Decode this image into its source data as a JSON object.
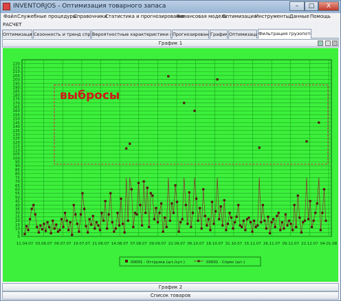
{
  "window": {
    "title": "INVENTORJOS - Оптимизация товарного запаса",
    "minimize_label": "–",
    "maximize_label": "□",
    "close_label": "X"
  },
  "menu": [
    "Файл",
    "Служебные процедуры",
    "Справочники",
    "Статистика и прогнозирование",
    "Финансовая модель",
    "Оптимизация",
    "Инструменты",
    "Данные",
    "Помощь"
  ],
  "section_label": "РАСЧЕТ",
  "tabs": [
    {
      "label": "Оптимизация",
      "active": false
    },
    {
      "label": "Сезонность и тренд спроса",
      "active": false
    },
    {
      "label": "Вероятностные характеристики спроса",
      "active": false
    },
    {
      "label": "Прогнозирование",
      "active": false
    },
    {
      "label": "Графики",
      "active": false
    },
    {
      "label": "Оптимизация",
      "active": false
    },
    {
      "label": "Фильтрация грузопотока",
      "active": true
    }
  ],
  "panel": {
    "title": "График 1"
  },
  "footer": {
    "panel2_title": "График 2",
    "goods_list": "Список товаров"
  },
  "colors": {
    "plot_bg": "#3cf03c",
    "grid": "#1aa01a",
    "line": "#8b2e2e",
    "marker": "#5a1010",
    "outlier_box": "#c04040",
    "annotation": "#d01818"
  },
  "chart_data": {
    "type": "line",
    "annotation": "выбросы",
    "ylim": [
      0,
      225
    ],
    "yticks": [
      0,
      5,
      10,
      15,
      20,
      25,
      30,
      35,
      40,
      45,
      50,
      55,
      60,
      65,
      70,
      75,
      80,
      85,
      90,
      95,
      100,
      105,
      110,
      115,
      120,
      125,
      130,
      135,
      140,
      145,
      150,
      155,
      160,
      165,
      170,
      175,
      180,
      185,
      190,
      195,
      200,
      205,
      210,
      215,
      220
    ],
    "x_tick_labels": [
      "11.04.07",
      "03.06.07",
      "06.07.07",
      "19.07.07",
      "21.06.07",
      "14.08.07",
      "07.08.07",
      "09.09.07",
      "22.09.07",
      "06.10.07",
      "18.10.07",
      "31.10.07",
      "15.11.07",
      "26.11.07",
      "09.12.07",
      "22.12.07",
      "04.01.08"
    ],
    "series": [
      {
        "name": "00001 - Отгрузка (шт./сут.)",
        "values": [
          3,
          13,
          8,
          22,
          35,
          40,
          28,
          12,
          5,
          14,
          9,
          16,
          7,
          18,
          12,
          4,
          20,
          10,
          15,
          6,
          8,
          22,
          12,
          30,
          20,
          8,
          18,
          2,
          40,
          28,
          16,
          6,
          28,
          55,
          35,
          13,
          5,
          22,
          15,
          26,
          10,
          18,
          14,
          8,
          30,
          20,
          45,
          10,
          28,
          55,
          18,
          6,
          10,
          30,
          14,
          48,
          16,
          5,
          112,
          20,
          118,
          60,
          12,
          30,
          28,
          68,
          40,
          14,
          70,
          30,
          62,
          12,
          55,
          52,
          22,
          36,
          18,
          30,
          42,
          6,
          24,
          12,
          204,
          20,
          42,
          30,
          65,
          44,
          6,
          18,
          22,
          170,
          40,
          16,
          56,
          12,
          30,
          160,
          48,
          20,
          36,
          10,
          60,
          26,
          14,
          22,
          8,
          44,
          16,
          32,
          200,
          22,
          38,
          14,
          46,
          8,
          16,
          30,
          24,
          10,
          18,
          25,
          40,
          14,
          12,
          20,
          8,
          22,
          24,
          18,
          6,
          20,
          12,
          14,
          113,
          18,
          40,
          20,
          10,
          25,
          4,
          18,
          22,
          12,
          26,
          30,
          8,
          18,
          10,
          28,
          14,
          20,
          16,
          8,
          40,
          12,
          52,
          24,
          5,
          18,
          20,
          121,
          22,
          45,
          12,
          20,
          30,
          42,
          145,
          8,
          30,
          60,
          20
        ]
      },
      {
        "name": "00001 - Спрос (шт.)",
        "style": "line"
      }
    ]
  }
}
